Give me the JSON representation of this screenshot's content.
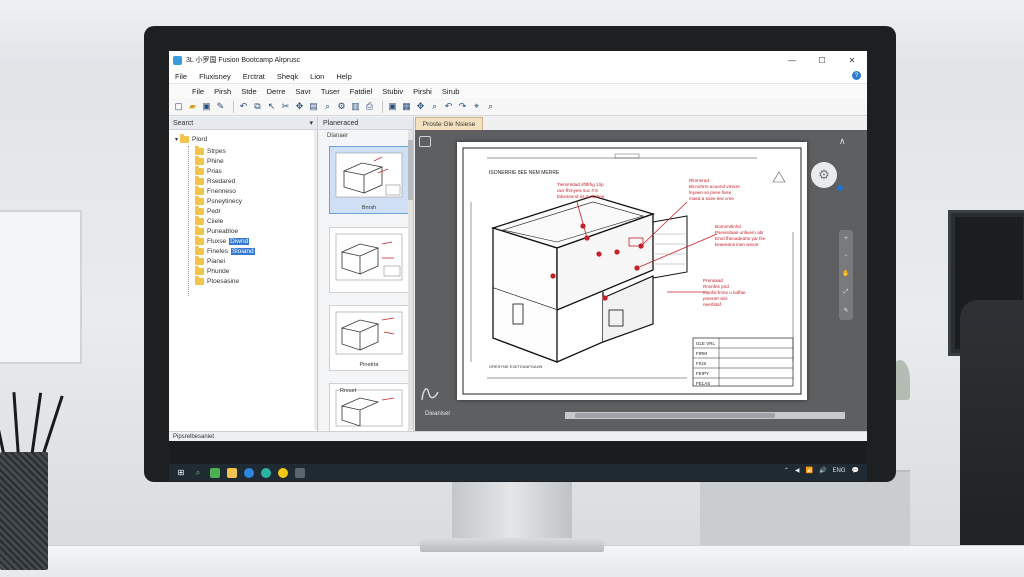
{
  "window": {
    "title": "3L 小罗国 Fusion Bootcamp Alrprusc"
  },
  "menu": {
    "items": [
      "File",
      "Fluxisney",
      "Erctrat",
      "Sheqk",
      "Lion",
      "Help"
    ]
  },
  "ribbon": {
    "items": [
      "File",
      "Pirsh",
      "Stde",
      "Derre",
      "Savr",
      "Tuser",
      "Fatdiel",
      "Stubiv",
      "Pirshi",
      "Sirub"
    ]
  },
  "tree_pane": {
    "header": "Searct",
    "root": "Plord",
    "items": [
      "Strpes",
      "Phine",
      "Prias",
      "Rsedared",
      "Fnenneso",
      "Psneytinecy",
      "Pedr",
      "Ciiele",
      "Puneabloe",
      "Fluxse",
      "Fineles",
      "Pianei",
      "Phunde",
      "Ptoesasine"
    ],
    "selected_lines": [
      "Diwnd",
      "Sloiand"
    ]
  },
  "thumbs_pane": {
    "header": "Planeraced",
    "subheader": "Dlanaer",
    "items": [
      "Bnrsh",
      "",
      "Pinetrta",
      "Rrvuet"
    ]
  },
  "viewer": {
    "tab": "Proste Gle Nsiese",
    "bottom_label": "Dieaniser",
    "drawing_title": "ISONERRIE 8EE NEM MERRE",
    "annotations": [
      "Tiemmtdad sfltfrhg 1/ip\nuwr fhrnyeis suc #.5\ntahesennd ns & ritnbee",
      "Rlnmnrad\nBicnohrre acuend vmivre\nfeyaen xo pnee fixse\nmaed a suee lew cree",
      "Bormmitinhd\nPsevisitaas unfiuem abr\nEnrd fhenadeahe yar fire\nkeaeeans inen wevar",
      "Prensaad\nRnvnfes pnd\nmanfsi fmne u kaffae\npmerarr tins\nneerfstaf"
    ],
    "scale_label": "ORESYNE EXETEANFGAHN",
    "titleblock": [
      "GLE VRL",
      "FIRM",
      "FIUS",
      "FEIPY",
      "FELAS"
    ]
  },
  "statusbar": {
    "text": "Pipsrelbesaniet"
  },
  "taskbar": {
    "tray": [
      "⌃",
      "◀",
      "📶",
      "🔊",
      "ENG",
      "💬"
    ]
  },
  "colors": {
    "annotation": "#c8202a",
    "accent": "#3478d6",
    "folder": "#f2c44d"
  }
}
